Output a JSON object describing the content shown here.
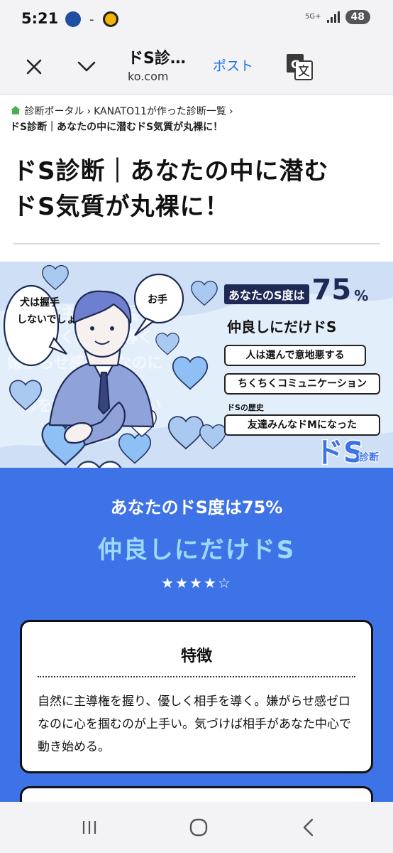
{
  "status": {
    "time": "5:21",
    "separator": "-",
    "network": "5G+",
    "battery": "48"
  },
  "browser": {
    "page_title_short": "ドS診…",
    "domain": "ko.com",
    "post_label": "ポスト",
    "icons": [
      "close-icon",
      "chevron-down-icon",
      "translate-icon"
    ]
  },
  "breadcrumb": {
    "home": "診断ポータル",
    "creator": "KANATO11が作った診断一覧",
    "current": "ドS診断｜あなたの中に潜むドS気質が丸裸に！"
  },
  "heading": {
    "line1": "ドS診断｜あなたの中に潜む",
    "line2": "ドS気質が丸裸に！"
  },
  "hero": {
    "score_prefix": "あなたのS度は",
    "score_number": "75",
    "score_unit": "%",
    "type_name": "仲良しにだけドS",
    "trait1": "人は選んで意地悪する",
    "trait2": "ちくちくコミュニケーション",
    "history_label": "ドSの歴史",
    "history": "友達みんなドMになった",
    "bubble_left": "犬は握手しないでしょ",
    "bubble_right": "お手",
    "logo_main": "ドS",
    "logo_sub": "診断",
    "bg_text": [
      "自然に主導権を握り",
      "優しく相手を導く",
      "嫌がらせ感ゼロなのに",
      "心を掴むのが上手い"
    ]
  },
  "result": {
    "score_text": "あなたのドS度は75%",
    "type_name": "仲良しにだけドS",
    "stars": "★★★★☆",
    "feature_title": "特徴",
    "feature_text": "自然に主導権を握り、優しく相手を導く。嫌がらせ感ゼロなのに心を掴むのが上手い。気づけば相手があなた中心で動き始める。"
  },
  "colors": {
    "accent_blue": "#3d73e6",
    "type_cyan": "#9fd9ff",
    "hero_bg": "#cfe0f6",
    "link_blue": "#1a73e8"
  },
  "nav": {
    "icons": [
      "recent-apps-icon",
      "home-icon",
      "back-icon"
    ]
  }
}
